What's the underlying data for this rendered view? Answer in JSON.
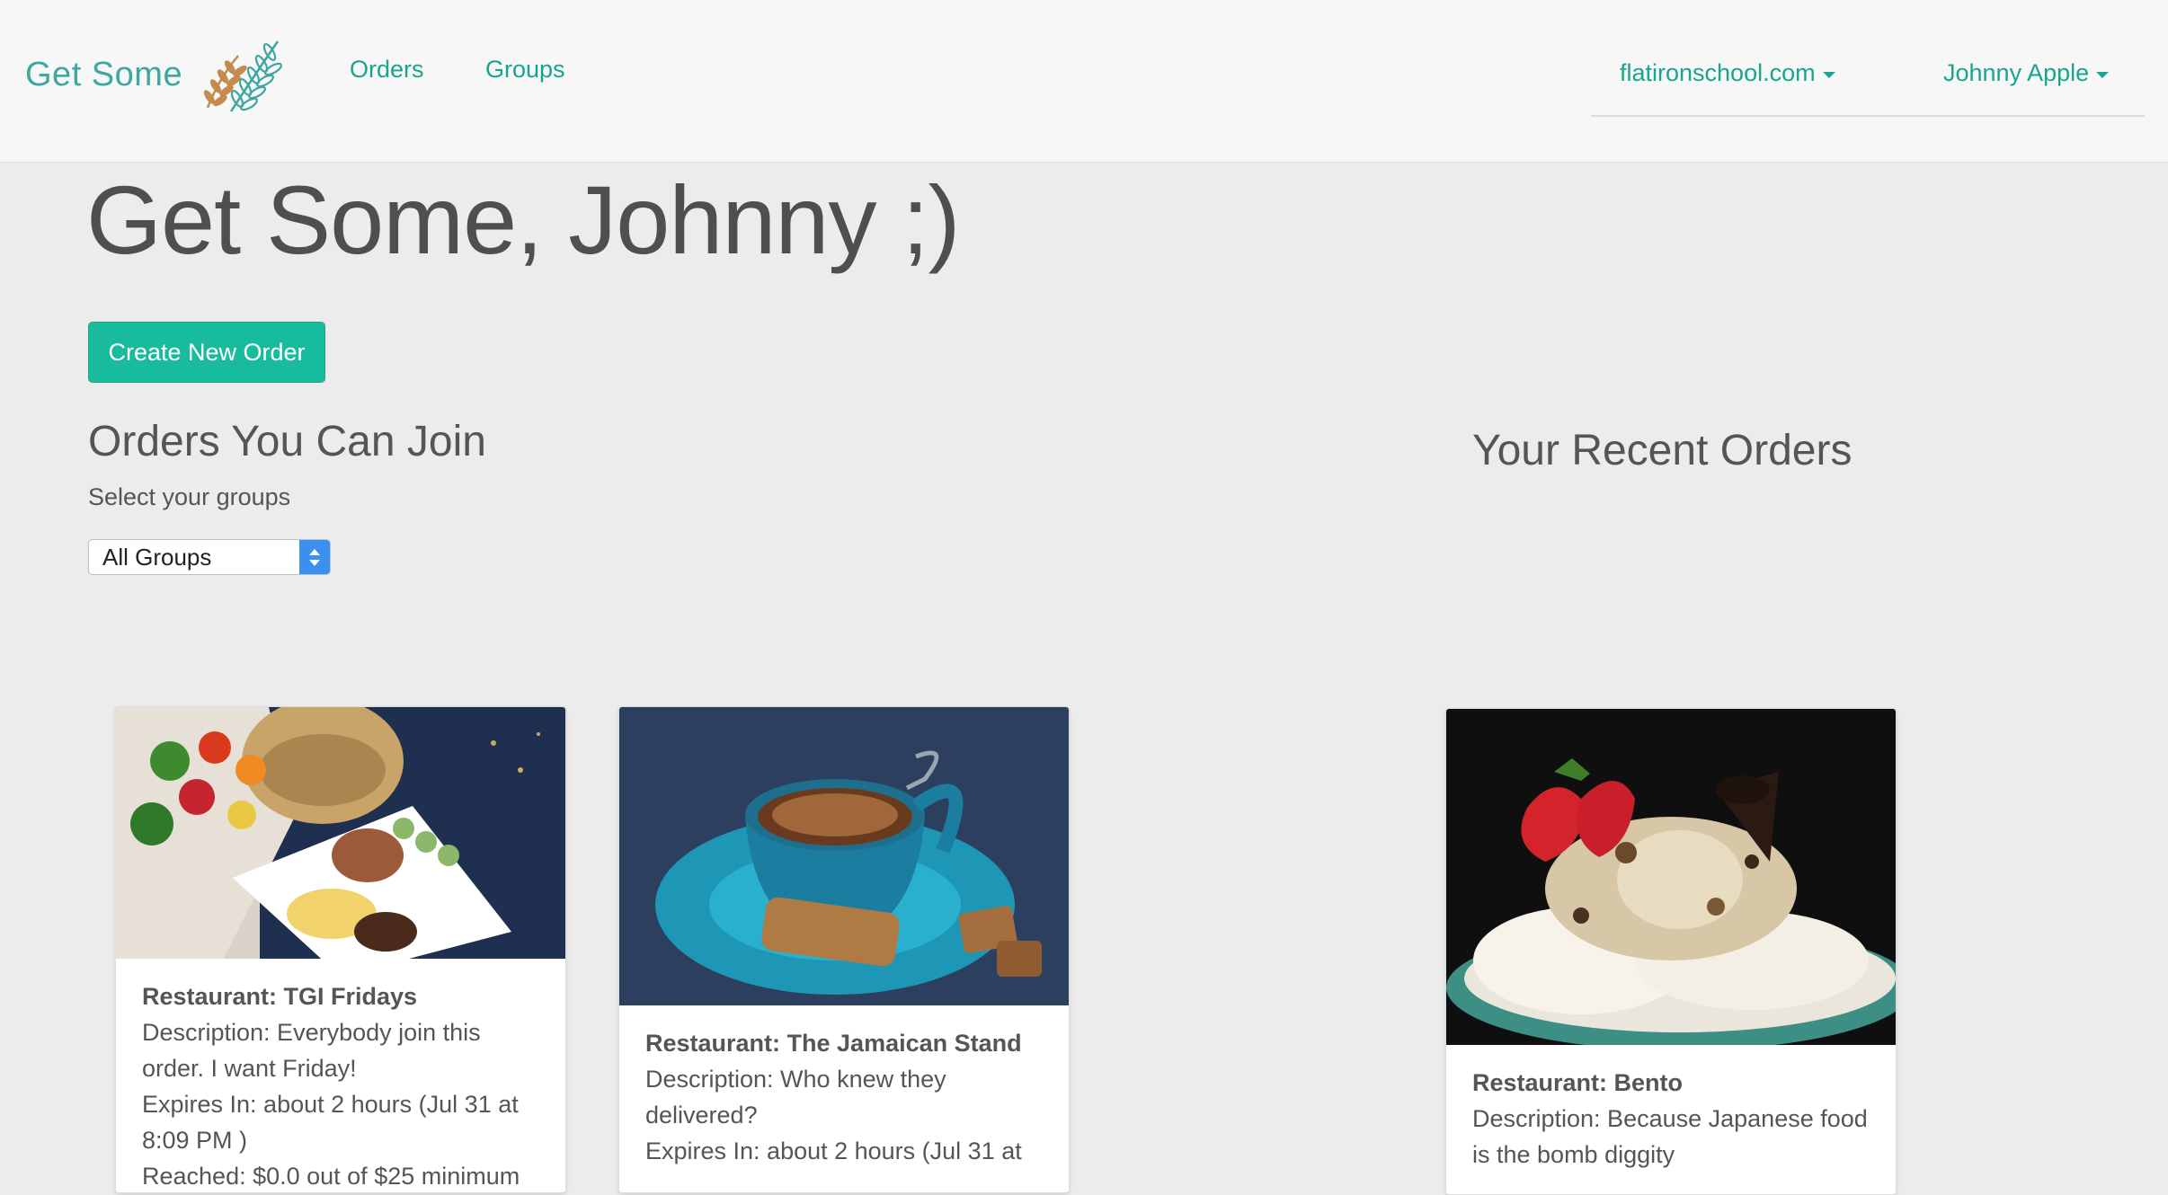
{
  "app": {
    "brand": "Get Some"
  },
  "nav": {
    "links": [
      {
        "label": "Orders"
      },
      {
        "label": "Groups"
      }
    ],
    "domain_dropdown": "flatironschool.com",
    "user_dropdown": "Johnny Apple",
    "colors": {
      "link": "#1aa58b",
      "brand": "#3fa6a0"
    }
  },
  "main": {
    "title": "Get Some, Johnny ;)",
    "create_button": "Create New Order",
    "join_section": {
      "title": "Orders You Can Join",
      "select_label": "Select your groups",
      "select_value": "All Groups"
    },
    "recent_section": {
      "title": "Your Recent Orders"
    },
    "button_color": "#18bc9c"
  },
  "cards": [
    {
      "image": "food-plate-with-vegetables",
      "restaurant": "Restaurant: TGI Fridays",
      "description": "Description: Everybody join this order. I want Friday!",
      "expires": "Expires In: about 2 hours (Jul 31 at 8:09 PM )",
      "reached": "Reached: $0.0 out of $25 minimum"
    },
    {
      "image": "coffee-cup-with-biscotti",
      "restaurant": "Restaurant: The Jamaican Stand",
      "description": "Description: Who knew they delivered?",
      "expires": "Expires In: about 2 hours (Jul 31 at"
    },
    {
      "image": "ice-cream-dessert-with-strawberry",
      "restaurant": "Restaurant: Bento",
      "description": "Description: Because Japanese food is the bomb diggity"
    }
  ]
}
